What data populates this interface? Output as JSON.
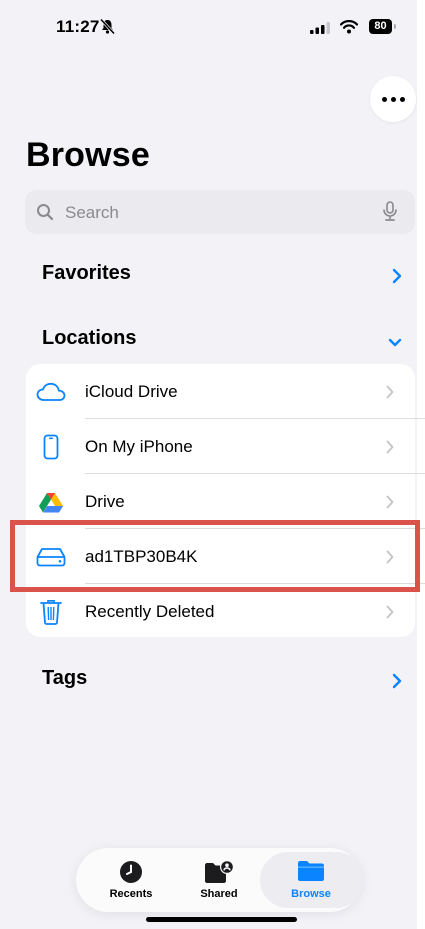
{
  "status_bar": {
    "time": "11:27",
    "battery": "80"
  },
  "page": {
    "title": "Browse"
  },
  "search": {
    "placeholder": "Search"
  },
  "favorites": {
    "label": "Favorites"
  },
  "locations": {
    "label": "Locations",
    "items": [
      {
        "label": "iCloud Drive",
        "icon": "cloud-icon"
      },
      {
        "label": "On My iPhone",
        "icon": "phone-icon"
      },
      {
        "label": "Drive",
        "icon": "google-drive-icon"
      },
      {
        "label": "ad1TBP30B4K",
        "icon": "external-drive-icon"
      },
      {
        "label": "Recently Deleted",
        "icon": "trash-icon"
      }
    ]
  },
  "tags": {
    "label": "Tags"
  },
  "tab_bar": {
    "tabs": [
      {
        "label": "Recents",
        "icon": "clock-icon"
      },
      {
        "label": "Shared",
        "icon": "shared-folder-icon"
      },
      {
        "label": "Browse",
        "icon": "folder-icon"
      }
    ],
    "active": "Browse"
  },
  "colors": {
    "accent": "#0a84ff",
    "highlight": "#d9534a",
    "background": "#f2f2f7"
  }
}
